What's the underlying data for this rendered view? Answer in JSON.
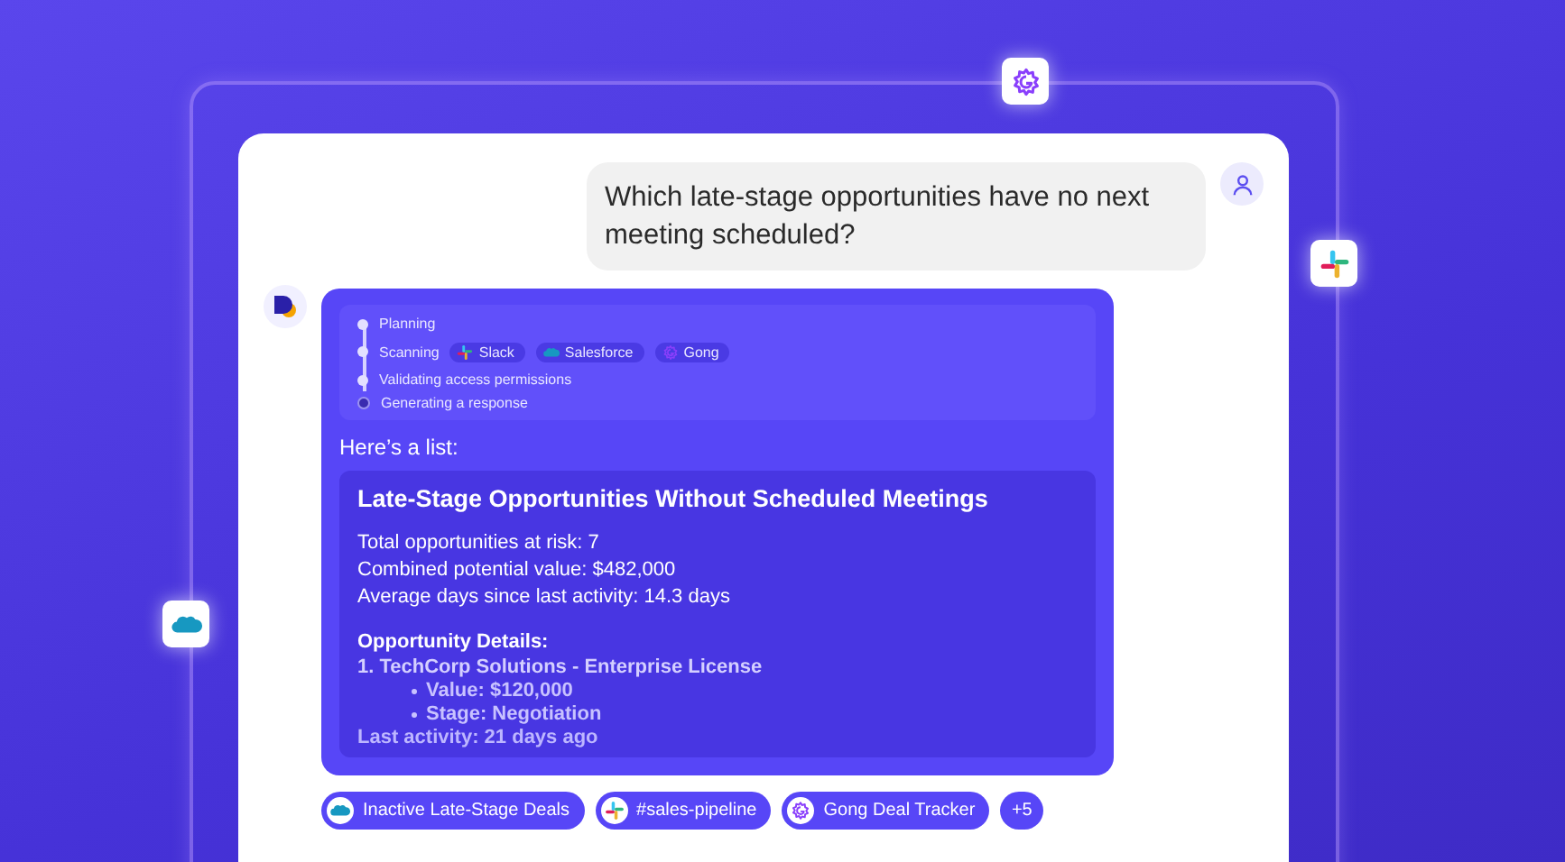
{
  "floating_icons": [
    {
      "kind": "gong"
    },
    {
      "kind": "slack"
    },
    {
      "kind": "salesforce"
    }
  ],
  "user_message": {
    "text": "Which late-stage opportunities have no next meeting scheduled?"
  },
  "assistant": {
    "steps": [
      {
        "label": "Planning",
        "done": true
      },
      {
        "label": "Scanning",
        "done": true,
        "sources": [
          {
            "label": "Slack",
            "kind": "slack"
          },
          {
            "label": "Salesforce",
            "kind": "salesforce"
          },
          {
            "label": "Gong",
            "kind": "gong"
          }
        ]
      },
      {
        "label": "Validating access permissions",
        "done": true
      },
      {
        "label": "Generating a response",
        "done": false
      }
    ],
    "intro": "Here’s a list:",
    "card": {
      "title": "Late-Stage Opportunities Without Scheduled Meetings",
      "stats": [
        "Total opportunities at risk: 7",
        "Combined potential value: $482,000",
        "Average days since last activity: 14.3 days"
      ],
      "details_heading": "Opportunity Details:",
      "item": "1. TechCorp Solutions - Enterprise License",
      "bullets": [
        "Value: $120,000",
        "Stage: Negotiation"
      ],
      "last_line": "Last activity: 21 days ago"
    }
  },
  "sources": [
    {
      "label": "Inactive Late-Stage Deals",
      "kind": "salesforce"
    },
    {
      "label": "#sales-pipeline",
      "kind": "slack"
    },
    {
      "label": "Gong Deal Tracker",
      "kind": "gong"
    }
  ],
  "more": "+5"
}
